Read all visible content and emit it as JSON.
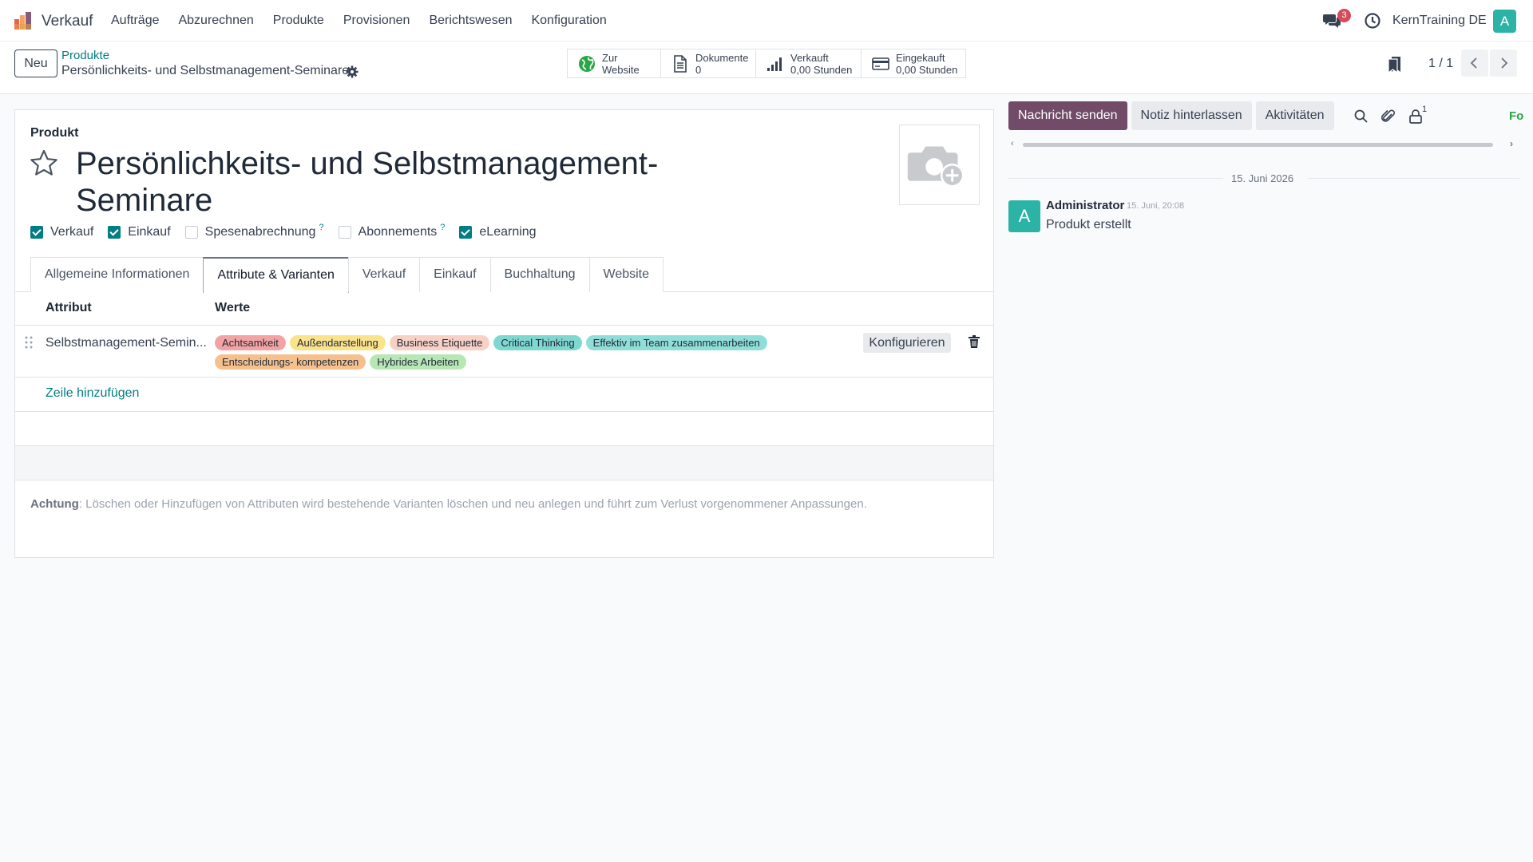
{
  "nav": {
    "app_name": "Verkauf",
    "menu": [
      "Aufträge",
      "Abzurechnen",
      "Produkte",
      "Provisionen",
      "Berichtswesen",
      "Konfiguration"
    ],
    "message_count": "3",
    "company": "KernTraining DE",
    "avatar_letter": "A"
  },
  "control": {
    "new_label": "Neu",
    "breadcrumb_parent": "Produkte",
    "breadcrumb_current": "Persönlichkeits- und Selbstmanagement-Seminare",
    "smart_buttons": [
      {
        "line1": "Zur",
        "line2": "Website",
        "icon": "globe-icon"
      },
      {
        "line1": "Dokumente",
        "line2": "0",
        "icon": "document-icon"
      },
      {
        "line1": "Verkauft",
        "line2": "0,00 Stunden",
        "icon": "bar-chart-icon"
      },
      {
        "line1": "Eingekauft",
        "line2": "0,00 Stunden",
        "icon": "credit-card-icon"
      }
    ],
    "pager": "1 / 1"
  },
  "form": {
    "type_label": "Produkt",
    "title": "Persönlichkeits- und Selbstmanagement-Seminare",
    "checkboxes": [
      {
        "label": "Verkauf",
        "checked": true,
        "help": ""
      },
      {
        "label": "Einkauf",
        "checked": true,
        "help": ""
      },
      {
        "label": "Spesenabrechnung",
        "checked": false,
        "help": "?"
      },
      {
        "label": "Abonnements",
        "checked": false,
        "help": "?"
      },
      {
        "label": "eLearning",
        "checked": true,
        "help": ""
      }
    ],
    "tabs": [
      "Allgemeine Informationen",
      "Attribute & Varianten",
      "Verkauf",
      "Einkauf",
      "Buchhaltung",
      "Website"
    ],
    "active_tab": "Attribute & Varianten",
    "table": {
      "col_attribute": "Attribut",
      "col_values": "Werte",
      "rows": [
        {
          "attribute": "Selbstmanagement-Semin...",
          "values": [
            {
              "label": "Achtsamkeit",
              "color": "#f4a3a3"
            },
            {
              "label": "Außendarstellung",
              "color": "#fbe38c"
            },
            {
              "label": "Business Etiquette",
              "color": "#f8d1c6"
            },
            {
              "label": "Critical Thinking",
              "color": "#7fd8cf"
            },
            {
              "label": "Effektiv im Team zusammenarbeiten",
              "color": "#8fdfd8"
            },
            {
              "label": "Entscheidungs- kompetenzen",
              "color": "#f6c08d"
            },
            {
              "label": "Hybrides Arbeiten",
              "color": "#b8e6b4"
            }
          ],
          "configure_label": "Konfigurieren"
        }
      ],
      "add_line": "Zeile hinzufügen"
    },
    "warning_label": "Achtung",
    "warning_text": ": Löschen oder Hinzufügen von Attributen wird bestehende Varianten löschen und neu anlegen und führt zum Verlust vorgenommener Anpassungen."
  },
  "chatter": {
    "send_message": "Nachricht senden",
    "log_note": "Notiz hinterlassen",
    "activities": "Aktivitäten",
    "follower_count": "1",
    "follow_label": "Fo",
    "date_separator": "15. Juni 2026",
    "messages": [
      {
        "author": "Administrator",
        "time": "15. Juni, 20:08",
        "body": "Produkt erstellt",
        "avatar": "A"
      }
    ]
  }
}
